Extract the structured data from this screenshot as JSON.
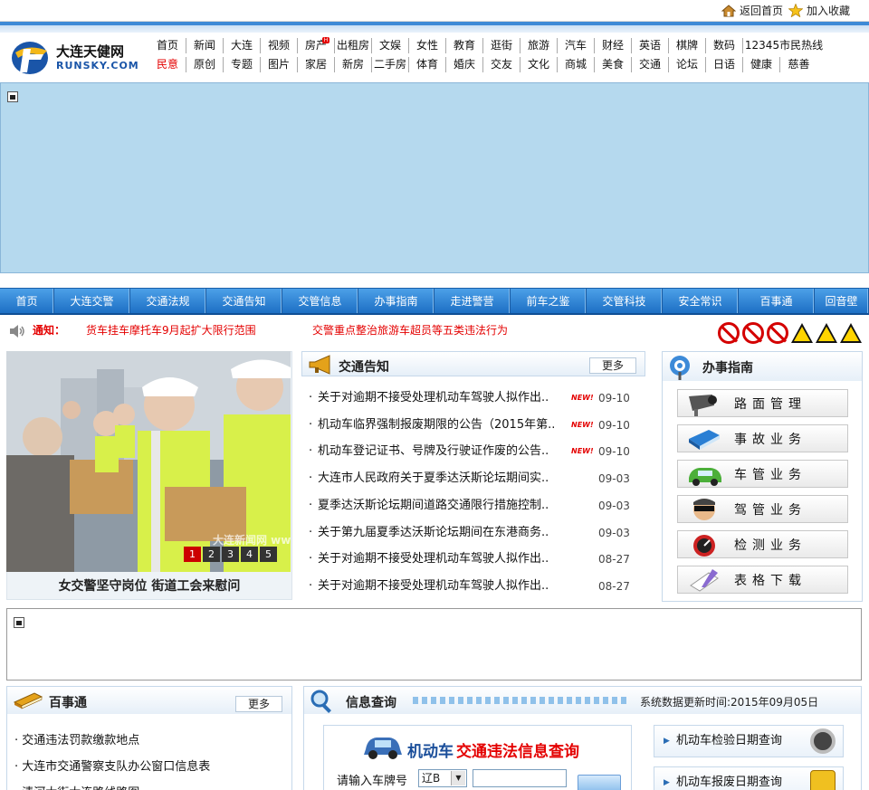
{
  "topbar": {
    "home_label": "返回首页",
    "favorite_label": "加入收藏"
  },
  "logo": {
    "cn": "大连天健网",
    "en": "RUNSKY.COM"
  },
  "nav": {
    "row1": [
      "首页",
      "新闻",
      "大连",
      "视频",
      "房产",
      "出租房",
      "文娱",
      "女性",
      "教育",
      "逛街",
      "旅游",
      "汽车",
      "财经",
      "英语",
      "棋牌",
      "数码",
      "12345市民热线"
    ],
    "row2": [
      "民意",
      "原创",
      "专题",
      "图片",
      "家居",
      "新房",
      "二手房",
      "体育",
      "婚庆",
      "交友",
      "文化",
      "商城",
      "美食",
      "交通",
      "论坛",
      "日语",
      "健康",
      "慈善"
    ]
  },
  "menu": [
    "首页",
    "大连交警",
    "交通法规",
    "交通告知",
    "交管信息",
    "办事指南",
    "走进警营",
    "前车之鉴",
    "交管科技",
    "安全常识",
    "百事通",
    "回音壁"
  ],
  "notice": {
    "label": "通知：",
    "items": [
      "货车挂车摩托车9月起扩大限行范围",
      "交警重点整治旅游车超员等五类违法行为"
    ]
  },
  "slider": {
    "caption": "女交警坚守岗位  街道工会来慰问",
    "pages": [
      "1",
      "2",
      "3",
      "4",
      "5"
    ],
    "watermark": "大连新闻网 www.dlxww.com"
  },
  "notices_box": {
    "title": "交通告知",
    "more": "更多",
    "new_badge": "NEW!",
    "items": [
      {
        "title": "关于对逾期不接受处理机动车驾驶人拟作出..",
        "date": "09-10",
        "new": true
      },
      {
        "title": "机动车临界强制报废期限的公告（2015年第..",
        "date": "09-10",
        "new": true
      },
      {
        "title": "机动车登记证书、号牌及行驶证作废的公告..",
        "date": "09-10",
        "new": true
      },
      {
        "title": "大连市人民政府关于夏季达沃斯论坛期间实..",
        "date": "09-03",
        "new": false
      },
      {
        "title": "夏季达沃斯论坛期间道路交通限行措施控制..",
        "date": "09-03",
        "new": false
      },
      {
        "title": "关于第九届夏季达沃斯论坛期间在东港商务..",
        "date": "09-03",
        "new": false
      },
      {
        "title": "关于对逾期不接受处理机动车驾驶人拟作出..",
        "date": "08-27",
        "new": false
      },
      {
        "title": "关于对逾期不接受处理机动车驾驶人拟作出..",
        "date": "08-27",
        "new": false
      }
    ]
  },
  "guide": {
    "title": "办事指南",
    "items": [
      {
        "label": "路面管理",
        "icon": "camera-icon"
      },
      {
        "label": "事故业务",
        "icon": "book-icon"
      },
      {
        "label": "车管业务",
        "icon": "car-icon"
      },
      {
        "label": "驾管业务",
        "icon": "driver-icon"
      },
      {
        "label": "检测业务",
        "icon": "gauge-icon"
      },
      {
        "label": "表格下载",
        "icon": "form-icon"
      }
    ]
  },
  "baishitong": {
    "title": "百事通",
    "more": "更多",
    "items": [
      "交通违法罚款缴款地点",
      "大连市交通警察支队办公窗口信息表",
      "清河大街大连路线路图"
    ]
  },
  "query": {
    "title": "信息查询",
    "updated": "系统数据更新时间:2015年09月05日",
    "heading_a": "机动车",
    "heading_b": "交通违法信息查询",
    "plate_label": "请输入车牌号",
    "plate_prefix": "辽B",
    "plate_value": "",
    "right_buttons": [
      "机动车检验日期查询",
      "机动车报废日期查询"
    ]
  },
  "colors": {
    "menu_blue": "#1d6fc4",
    "notice_red": "#e40000",
    "banner_bg": "#b5d9ee"
  }
}
